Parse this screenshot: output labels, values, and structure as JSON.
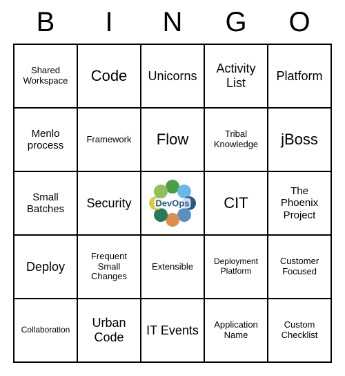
{
  "header": [
    "B",
    "I",
    "N",
    "G",
    "O"
  ],
  "grid": [
    [
      {
        "text": "Shared Workspace",
        "size": "sm"
      },
      {
        "text": "Code",
        "size": "lg"
      },
      {
        "text": "Unicorns",
        "size": "md"
      },
      {
        "text": "Activity List",
        "size": "md"
      },
      {
        "text": "Platform",
        "size": "md"
      }
    ],
    [
      {
        "text": "Menlo process",
        "size": ""
      },
      {
        "text": "Framework",
        "size": "sm"
      },
      {
        "text": "Flow",
        "size": "lg"
      },
      {
        "text": "Tribal Knowledge",
        "size": "sm"
      },
      {
        "text": "jBoss",
        "size": "lg"
      }
    ],
    [
      {
        "text": "Small Batches",
        "size": ""
      },
      {
        "text": "Security",
        "size": "md"
      },
      {
        "text": "DevOps",
        "size": "",
        "center": true
      },
      {
        "text": "CIT",
        "size": "lg"
      },
      {
        "text": "The Phoenix Project",
        "size": ""
      }
    ],
    [
      {
        "text": "Deploy",
        "size": "md"
      },
      {
        "text": "Frequent Small Changes",
        "size": "sm"
      },
      {
        "text": "Extensible",
        "size": "sm"
      },
      {
        "text": "Deployment Platform",
        "size": "xs"
      },
      {
        "text": "Customer Focused",
        "size": "sm"
      }
    ],
    [
      {
        "text": "Collaboration",
        "size": "xs"
      },
      {
        "text": "Urban Code",
        "size": "md"
      },
      {
        "text": "IT Events",
        "size": "md"
      },
      {
        "text": "Application Name",
        "size": "sm"
      },
      {
        "text": "Custom Checklist",
        "size": "sm"
      }
    ]
  ]
}
